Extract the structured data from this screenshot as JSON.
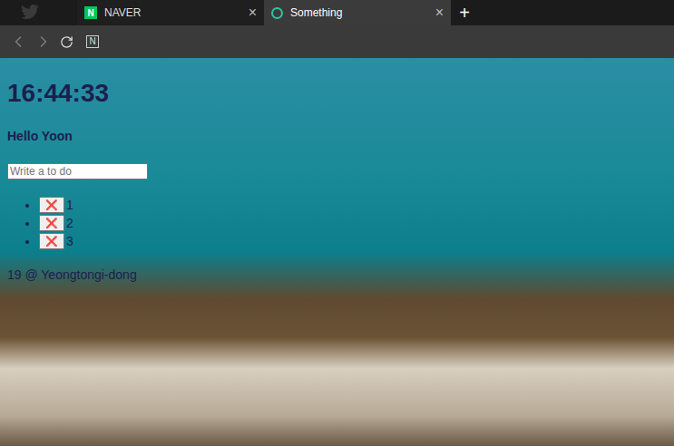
{
  "window": {
    "tab_close": "×",
    "new_tab": "+"
  },
  "tabs": [
    {
      "label": "NAVER",
      "icon_letter": "N",
      "selected": false
    },
    {
      "label": "Something",
      "icon_letter": "",
      "selected": true
    }
  ],
  "nav": {
    "extension_letter": "N"
  },
  "page": {
    "clock": "16:44:33",
    "greeting": "Hello Yoon",
    "todo_placeholder": "Write a to do",
    "todos": [
      {
        "text": "1",
        "button": "❌"
      },
      {
        "text": "2",
        "button": "❌"
      },
      {
        "text": "3",
        "button": "❌"
      }
    ],
    "weather": "19 @ Yeongtongi-dong"
  }
}
